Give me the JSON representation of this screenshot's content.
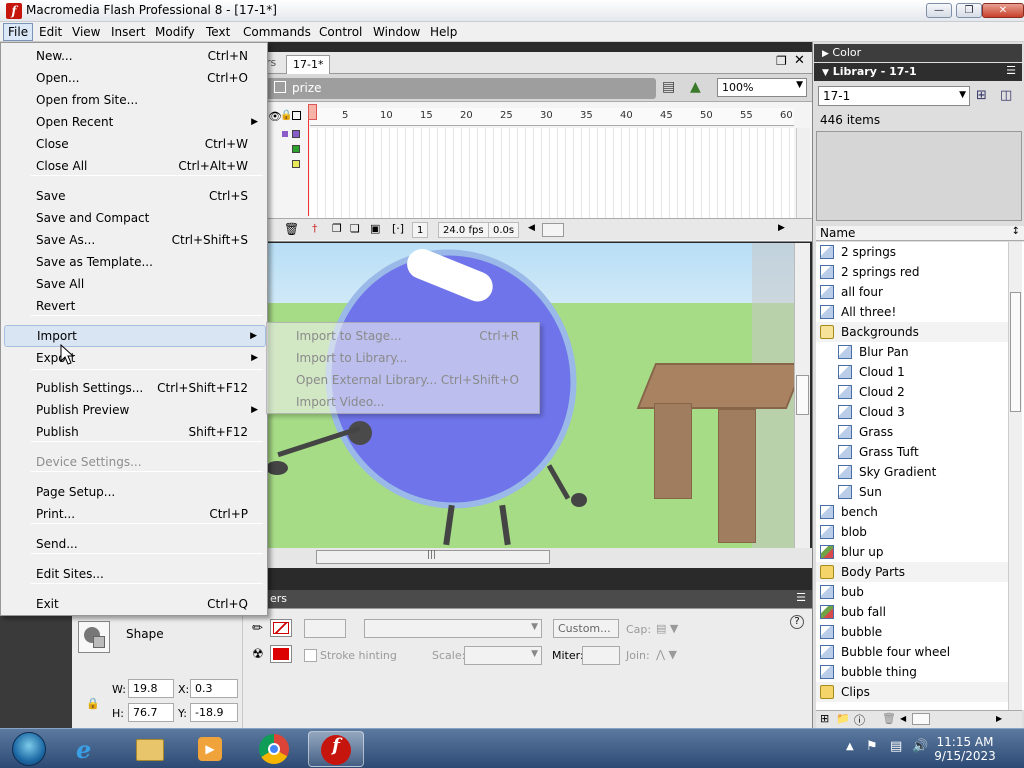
{
  "window": {
    "title": "Macromedia Flash Professional 8 - [17-1*]"
  },
  "menubar": [
    "File",
    "Edit",
    "View",
    "Insert",
    "Modify",
    "Text",
    "Commands",
    "Control",
    "Window",
    "Help"
  ],
  "document": {
    "tab": "17-1*",
    "tab_prev": "rs",
    "scene": "prize",
    "zoom": "100%"
  },
  "timeline": {
    "ticks": [
      "5",
      "10",
      "15",
      "20",
      "25",
      "30",
      "35",
      "40",
      "45",
      "50",
      "55",
      "60"
    ],
    "frame": "1",
    "fps": "24.0 fps",
    "time": "0.0s"
  },
  "file_menu": {
    "items": [
      {
        "label": "New...",
        "shortcut": "Ctrl+N"
      },
      {
        "label": "Open...",
        "shortcut": "Ctrl+O"
      },
      {
        "label": "Open from Site...",
        "shortcut": ""
      },
      {
        "label": "Open Recent",
        "shortcut": "",
        "submenu": true
      },
      {
        "label": "Close",
        "shortcut": "Ctrl+W"
      },
      {
        "label": "Close All",
        "shortcut": "Ctrl+Alt+W"
      },
      {
        "label": "Save",
        "shortcut": "Ctrl+S"
      },
      {
        "label": "Save and Compact",
        "shortcut": ""
      },
      {
        "label": "Save As...",
        "shortcut": "Ctrl+Shift+S"
      },
      {
        "label": "Save as Template...",
        "shortcut": ""
      },
      {
        "label": "Save All",
        "shortcut": ""
      },
      {
        "label": "Revert",
        "shortcut": ""
      },
      {
        "label": "Import",
        "shortcut": "",
        "submenu": true
      },
      {
        "label": "Export",
        "shortcut": "",
        "submenu": true
      },
      {
        "label": "Publish Settings...",
        "shortcut": "Ctrl+Shift+F12"
      },
      {
        "label": "Publish Preview",
        "shortcut": "",
        "submenu": true
      },
      {
        "label": "Publish",
        "shortcut": "Shift+F12"
      },
      {
        "label": "Device Settings...",
        "shortcut": "",
        "disabled": true
      },
      {
        "label": "Page Setup...",
        "shortcut": ""
      },
      {
        "label": "Print...",
        "shortcut": "Ctrl+P"
      },
      {
        "label": "Send...",
        "shortcut": ""
      },
      {
        "label": "Edit Sites...",
        "shortcut": ""
      },
      {
        "label": "Exit",
        "shortcut": "Ctrl+Q"
      }
    ]
  },
  "import_submenu": [
    {
      "label": "Import to Stage...",
      "shortcut": "Ctrl+R"
    },
    {
      "label": "Import to Library...",
      "shortcut": ""
    },
    {
      "label": "Open External Library...",
      "shortcut": "Ctrl+Shift+O"
    },
    {
      "label": "Import Video...",
      "shortcut": ""
    }
  ],
  "properties": {
    "header": "ers",
    "type": "Shape",
    "w_label": "W:",
    "w": "19.8",
    "x_label": "X:",
    "x": "0.3",
    "h_label": "H:",
    "h": "76.7",
    "y_label": "Y:",
    "y": "-18.9",
    "stroke_hinting": "Stroke hinting",
    "scale": "Scale:",
    "custom": "Custom...",
    "miter": "Miter:",
    "cap": "Cap:",
    "join": "Join:"
  },
  "panels": {
    "color": "Color",
    "library": "Library - 17-1"
  },
  "library": {
    "selected": "17-1",
    "count": "446 items",
    "column": "Name",
    "items": [
      {
        "name": "2 springs",
        "type": "symbol",
        "indent": 0
      },
      {
        "name": "2 springs red",
        "type": "symbol",
        "indent": 0
      },
      {
        "name": "all four",
        "type": "symbol",
        "indent": 0
      },
      {
        "name": "All three!",
        "type": "symbol",
        "indent": 0
      },
      {
        "name": "Backgrounds",
        "type": "folder-open",
        "indent": 0
      },
      {
        "name": "Blur Pan",
        "type": "symbol",
        "indent": 1
      },
      {
        "name": "Cloud 1",
        "type": "symbol",
        "indent": 1
      },
      {
        "name": "Cloud 2",
        "type": "symbol",
        "indent": 1
      },
      {
        "name": "Cloud 3",
        "type": "symbol",
        "indent": 1
      },
      {
        "name": "Grass",
        "type": "symbol",
        "indent": 1
      },
      {
        "name": "Grass Tuft",
        "type": "symbol",
        "indent": 1
      },
      {
        "name": "Sky Gradient",
        "type": "symbol",
        "indent": 1
      },
      {
        "name": "Sun",
        "type": "symbol",
        "indent": 1
      },
      {
        "name": "bench",
        "type": "symbol",
        "indent": 0
      },
      {
        "name": "blob",
        "type": "symbol",
        "indent": 0
      },
      {
        "name": "blur up",
        "type": "bitmap",
        "indent": 0
      },
      {
        "name": "Body Parts",
        "type": "folder",
        "indent": 0
      },
      {
        "name": "bub",
        "type": "symbol",
        "indent": 0
      },
      {
        "name": "bub fall",
        "type": "bitmap",
        "indent": 0
      },
      {
        "name": "bubble",
        "type": "symbol",
        "indent": 0
      },
      {
        "name": "Bubble four wheel",
        "type": "symbol",
        "indent": 0
      },
      {
        "name": "bubble thing",
        "type": "symbol",
        "indent": 0
      },
      {
        "name": "Clips",
        "type": "folder",
        "indent": 0
      }
    ]
  },
  "taskbar": {
    "time": "11:15 AM",
    "date": "9/15/2023"
  }
}
